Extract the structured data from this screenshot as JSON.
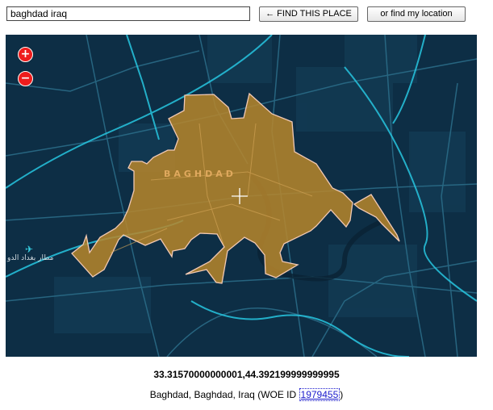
{
  "search": {
    "value": "baghdad iraq",
    "find_label": "← FIND THIS PLACE",
    "locate_label": "or find my location"
  },
  "map": {
    "zoom_in_label": "+",
    "zoom_out_label": "−",
    "city_label": "BAGHDAD",
    "airport_label": "مطار بغداد الدو",
    "colors": {
      "background": "#0d2e45",
      "roads": "#2a6b87",
      "highways": "#27c6e0",
      "polygon_fill": "#b8862a",
      "polygon_stroke": "#f2c9b3"
    }
  },
  "result": {
    "coords": "33.31570000000001,44.392199999999995",
    "place_prefix": "Baghdad, Baghdad, Iraq (WOE ID ",
    "woe_id": "1979455",
    "place_suffix": ")"
  }
}
